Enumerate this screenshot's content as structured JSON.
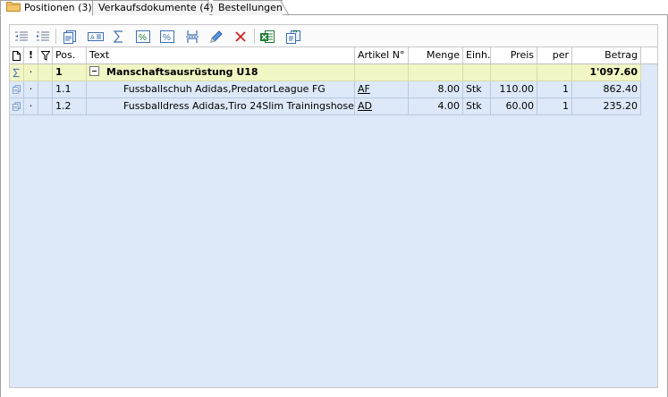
{
  "tabs": [
    {
      "label": "Positionen (3)",
      "active": true,
      "icon": "folder-icon"
    },
    {
      "label": "Verkaufsdokumente (4)",
      "active": false
    },
    {
      "label": "Bestellungen",
      "active": false
    }
  ],
  "toolbar": {
    "buttons": [
      "outdent-icon",
      "indent-icon",
      "document-icon",
      "text-block-icon",
      "sum-icon",
      "discount-percent-icon",
      "percent-icon",
      "page-break-icon",
      "edit-pencil-icon",
      "delete-x-icon",
      "excel-export-icon",
      "copy-document-icon"
    ]
  },
  "grid": {
    "headers": {
      "type": "",
      "flag": "!",
      "filter": "",
      "pos": "Pos.",
      "text": "Text",
      "article": "Artikel N°",
      "menge": "Menge",
      "einh": "Einh.",
      "preis": "Preis",
      "per": "per",
      "betrag": "Betrag"
    },
    "group": {
      "dot": "·",
      "pos": "1",
      "text": "Manschaftsausrüstung U18",
      "betrag": "1'097.60"
    },
    "rows": [
      {
        "dot": "·",
        "pos": "1.1",
        "text": "Fussballschuh Adidas,PredatorLeague FG",
        "article": "AF",
        "menge": "8.00",
        "einh": "Stk",
        "preis": "110.00",
        "per": "1",
        "betrag": "862.40"
      },
      {
        "dot": "·",
        "pos": "1.2",
        "text": "Fussballdress Adidas,Tiro 24Slim Trainingshose",
        "article": "AD",
        "menge": "4.00",
        "einh": "Stk",
        "preis": "60.00",
        "per": "1",
        "betrag": "235.20"
      }
    ]
  },
  "colors": {
    "grid_bg": "#dde9f8",
    "group_bg": "#f2f5c4",
    "delete_red": "#d42020",
    "excel_green": "#1f7a35"
  }
}
